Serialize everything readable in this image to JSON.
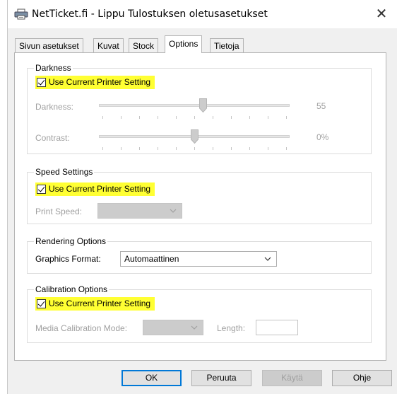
{
  "window": {
    "title": "NetTicket.fi - Lippu Tulostuksen oletusasetukset"
  },
  "tabs": [
    "Sivun asetukset",
    "Kuvat",
    "Stock",
    "Options",
    "Tietoja"
  ],
  "darkness": {
    "title": "Darkness",
    "use_current_label": "Use Current Printer Setting",
    "darkness_label": "Darkness:",
    "darkness_value": "55",
    "darkness_level": 0.55,
    "contrast_label": "Contrast:",
    "contrast_value": "0%",
    "contrast_level": 0.5
  },
  "speed": {
    "title": "Speed Settings",
    "use_current_label": "Use Current Printer Setting",
    "print_speed_label": "Print Speed:",
    "print_speed_value": ""
  },
  "rendering": {
    "title": "Rendering Options",
    "graphics_format_label": "Graphics Format:",
    "graphics_format_value": "Automaattinen"
  },
  "calibration": {
    "title": "Calibration Options",
    "use_current_label": "Use Current Printer Setting",
    "media_mode_label": "Media Calibration Mode:",
    "media_mode_value": "",
    "length_label": "Length:",
    "length_value": ""
  },
  "buttons": {
    "ok": "OK",
    "cancel": "Peruuta",
    "apply": "Käytä",
    "help": "Ohje"
  },
  "colors": {
    "highlight": "#ffff33",
    "default_button_border": "#0078d7"
  }
}
